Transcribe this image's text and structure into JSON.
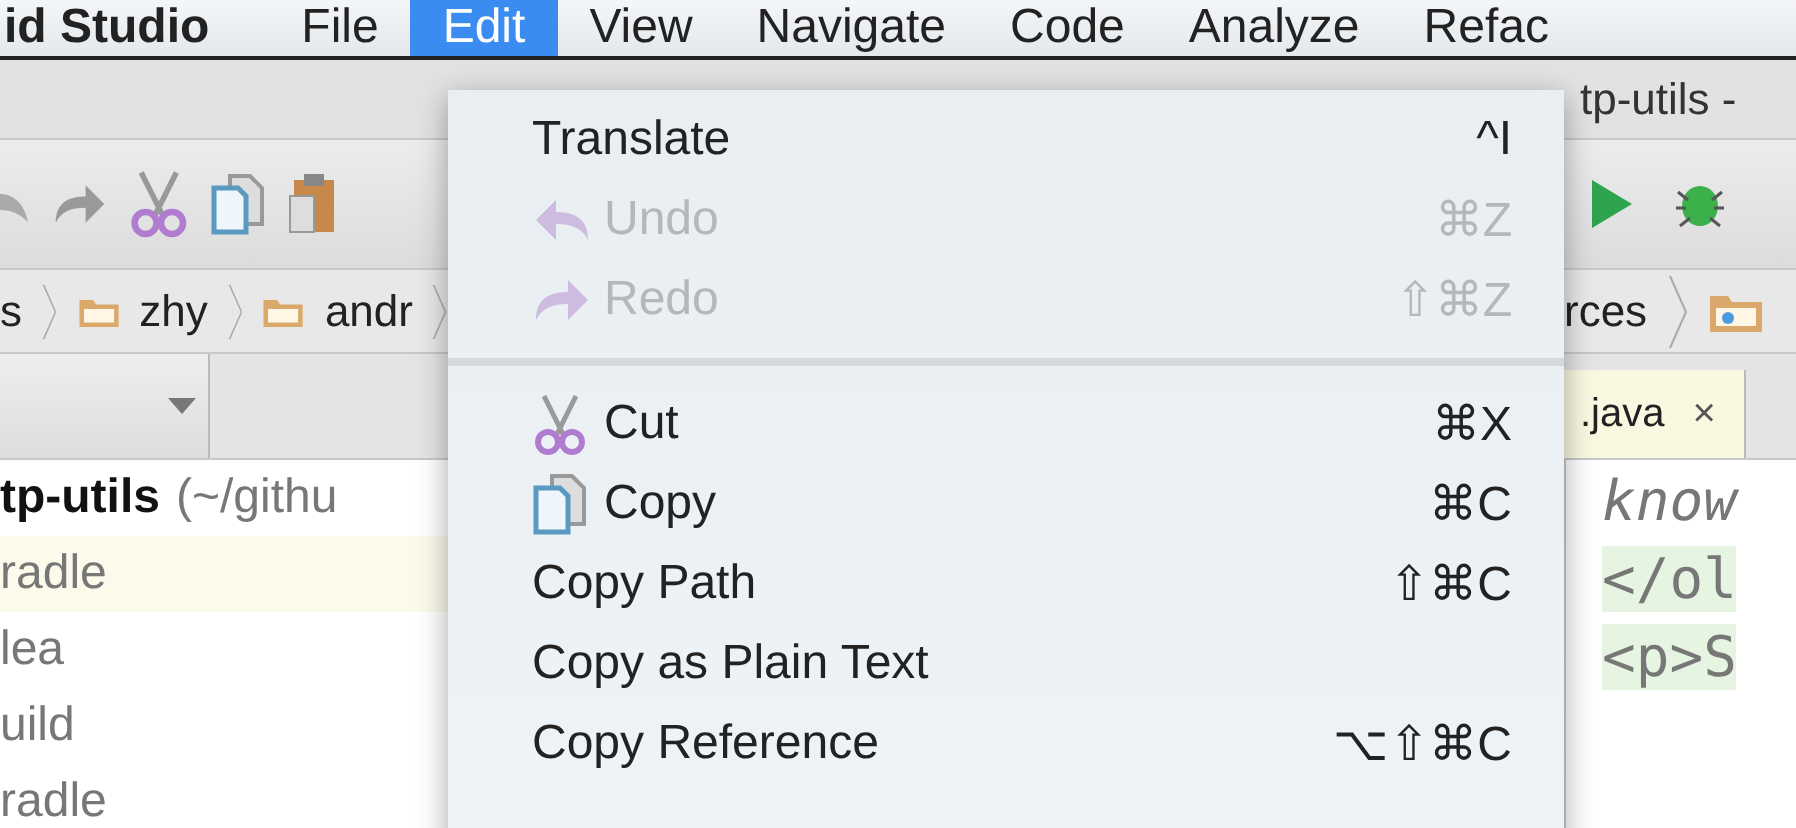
{
  "menu_bar": {
    "app": "id Studio",
    "menus": [
      {
        "label": "File",
        "selected": false
      },
      {
        "label": "Edit",
        "selected": true
      },
      {
        "label": "View",
        "selected": false
      },
      {
        "label": "Navigate",
        "selected": false
      },
      {
        "label": "Code",
        "selected": false
      },
      {
        "label": "Analyze",
        "selected": false
      },
      {
        "label": "Refac",
        "selected": false
      }
    ]
  },
  "window": {
    "title": "tp-utils -"
  },
  "breadcrumb": {
    "left": [
      "s",
      "zhy",
      "andr"
    ],
    "right": [
      "rces"
    ]
  },
  "editor_tab": {
    "label": ".java",
    "close": "×"
  },
  "project_tree": {
    "root": "tp-utils",
    "root_path": "(~/githu",
    "items": [
      {
        "label": "radle",
        "selected": true
      },
      {
        "label": "lea",
        "selected": false
      },
      {
        "label": "uild",
        "selected": false
      },
      {
        "label": "radle",
        "selected": false
      }
    ]
  },
  "code_lines": [
    {
      "text": "know",
      "kind": "comment"
    },
    {
      "text": "</ol",
      "kind": "tag"
    },
    {
      "text": "<p>S",
      "kind": "tag"
    }
  ],
  "edit_menu": [
    {
      "kind": "item",
      "label": "Translate",
      "shortcut": "^I",
      "disabled": false
    },
    {
      "kind": "item",
      "label": "Undo",
      "shortcut": "⌘Z",
      "disabled": true
    },
    {
      "kind": "item",
      "label": "Redo",
      "shortcut": "⇧⌘Z",
      "disabled": true
    },
    {
      "kind": "separator"
    },
    {
      "kind": "item",
      "label": "Cut",
      "shortcut": "⌘X",
      "disabled": false
    },
    {
      "kind": "item",
      "label": "Copy",
      "shortcut": "⌘C",
      "disabled": false
    },
    {
      "kind": "item",
      "label": "Copy Path",
      "shortcut": "⇧⌘C",
      "disabled": false
    },
    {
      "kind": "item",
      "label": "Copy as Plain Text",
      "disabled": false
    },
    {
      "kind": "item",
      "label": "Copy Reference",
      "shortcut": "⌥⇧⌘C",
      "disabled": false
    }
  ]
}
